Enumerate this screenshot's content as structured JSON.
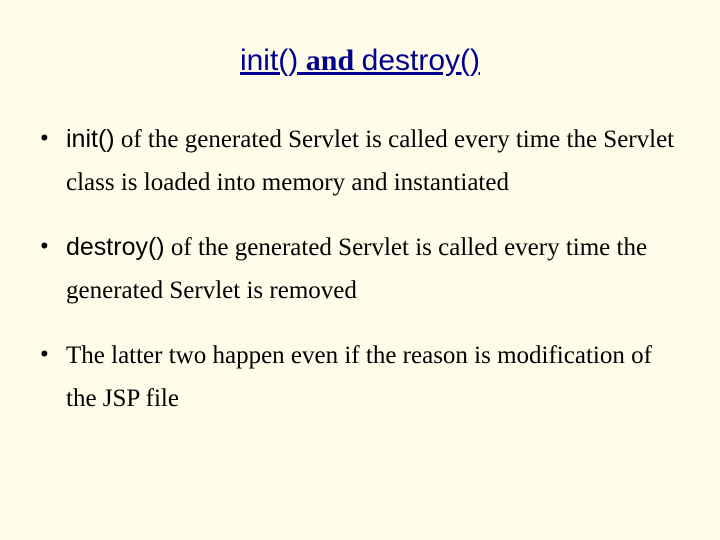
{
  "title": {
    "m1": "init()",
    "s1": " and ",
    "m2": "destroy()"
  },
  "bullets": [
    {
      "lead_mono": "init()",
      "rest": " of the generated Servlet is called every time the Servlet class is loaded into memory and instantiated"
    },
    {
      "lead_mono": "destroy()",
      "rest": " of the generated Servlet is called every time the generated Servlet is removed"
    },
    {
      "lead_mono": "",
      "rest": "The latter two happen even if the reason is modification of the JSP file"
    }
  ]
}
